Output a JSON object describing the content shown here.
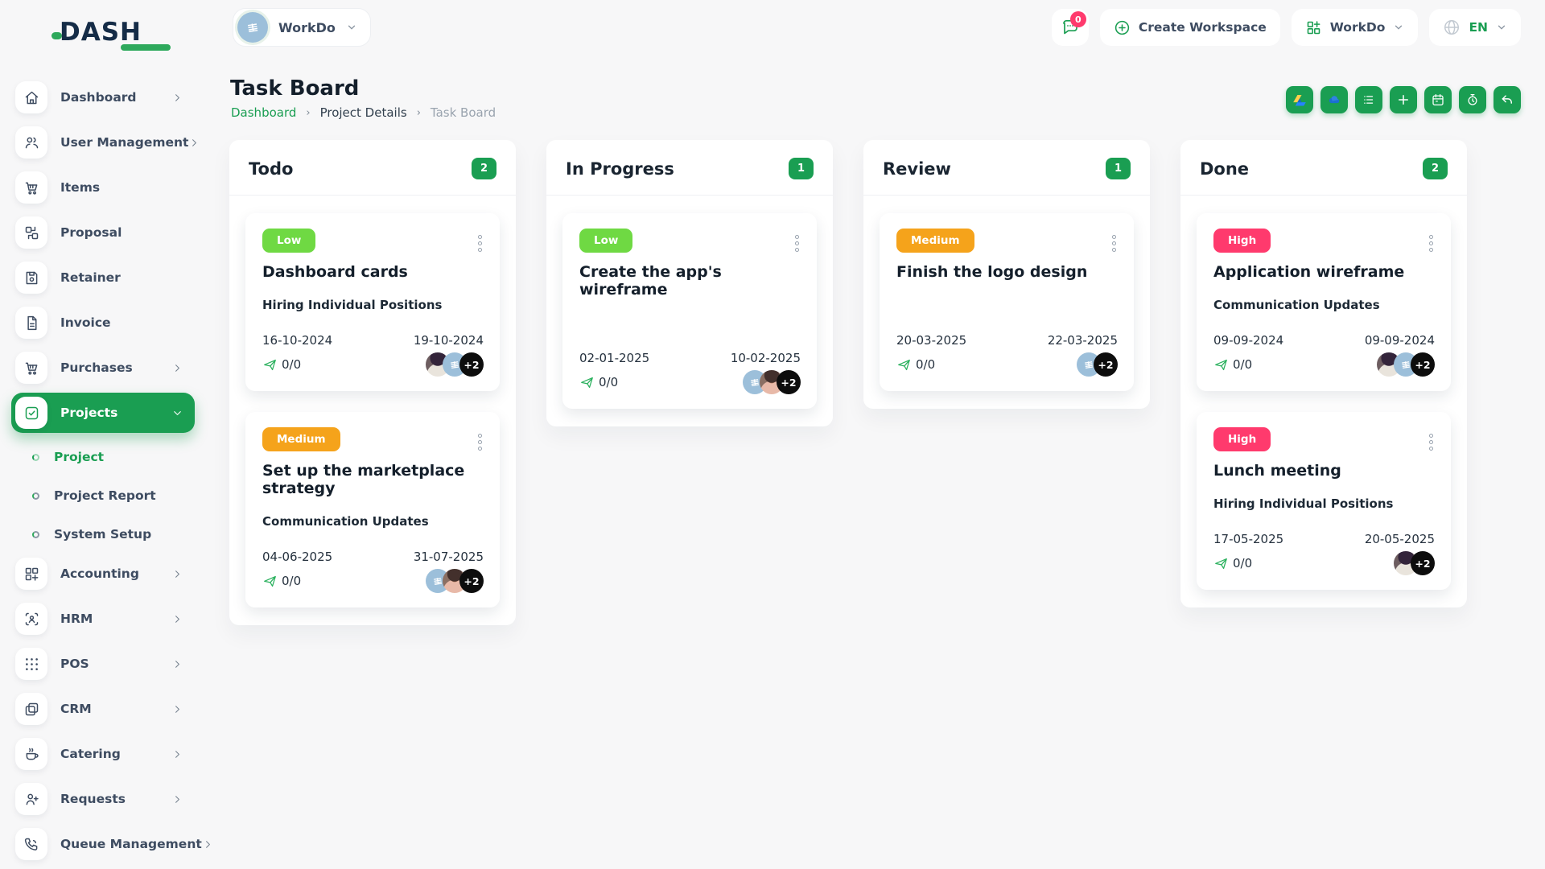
{
  "brand": {
    "logo_text": "DASH"
  },
  "header": {
    "workspace_pill": {
      "label": "WorkDo",
      "avatar_icon": "building-icon"
    },
    "messages": {
      "badge": "0",
      "icon": "chat-icon"
    },
    "create_workspace": {
      "label": "Create Workspace",
      "icon": "circle-plus-icon"
    },
    "app_switcher": {
      "label": "WorkDo",
      "icon": "grid-plus-icon"
    },
    "language": {
      "code": "EN",
      "icon": "globe-icon"
    }
  },
  "page": {
    "title": "Task Board",
    "breadcrumb": {
      "0": "Dashboard",
      "1": "Project Details",
      "2": "Task Board"
    }
  },
  "toolbar": {
    "buttons": [
      {
        "icon": "google-drive-icon",
        "name": "google-drive-button"
      },
      {
        "icon": "onedrive-icon",
        "name": "onedrive-button"
      },
      {
        "icon": "list-icon",
        "name": "list-view-button"
      },
      {
        "icon": "plus-icon",
        "name": "add-task-button"
      },
      {
        "icon": "calendar-icon",
        "name": "calendar-button"
      },
      {
        "icon": "alarm-icon",
        "name": "reminder-button"
      },
      {
        "icon": "undo-icon",
        "name": "back-button"
      }
    ]
  },
  "sidebar": {
    "items": [
      {
        "label": "Dashboard",
        "icon": "home",
        "chevron": "right"
      },
      {
        "label": "User Management",
        "icon": "users",
        "chevron": "right"
      },
      {
        "label": "Items",
        "icon": "cart",
        "chevron": ""
      },
      {
        "label": "Proposal",
        "icon": "swap",
        "chevron": ""
      },
      {
        "label": "Retainer",
        "icon": "save",
        "chevron": ""
      },
      {
        "label": "Invoice",
        "icon": "file",
        "chevron": ""
      },
      {
        "label": "Purchases",
        "icon": "cart",
        "chevron": "right"
      },
      {
        "label": "Projects",
        "icon": "check-square",
        "chevron": "down",
        "active": true,
        "children": [
          {
            "label": "Project",
            "active": true
          },
          {
            "label": "Project Report",
            "active": false
          },
          {
            "label": "System Setup",
            "active": false
          }
        ]
      },
      {
        "label": "Accounting",
        "icon": "grid-plus",
        "chevron": "right"
      },
      {
        "label": "HRM",
        "icon": "scan-user",
        "chevron": "right"
      },
      {
        "label": "POS",
        "icon": "dots-grid",
        "chevron": "right"
      },
      {
        "label": "CRM",
        "icon": "windows",
        "chevron": "right"
      },
      {
        "label": "Catering",
        "icon": "coffee",
        "chevron": "right"
      },
      {
        "label": "Requests",
        "icon": "user-plus",
        "chevron": "right"
      },
      {
        "label": "Queue Management",
        "icon": "phone",
        "chevron": "right"
      }
    ]
  },
  "board": {
    "columns": [
      {
        "title": "Todo",
        "count": "2",
        "cards": [
          {
            "priority": "Low",
            "title": "Dashboard cards",
            "milestone": "Hiring Individual Positions",
            "start_date": "16-10-2024",
            "end_date": "19-10-2024",
            "progress": "0/0",
            "avatars": [
              "photo1",
              "workdo"
            ],
            "overflow": "+2"
          },
          {
            "priority": "Medium",
            "title": "Set up the marketplace strategy",
            "milestone": "Communication Updates",
            "start_date": "04-06-2025",
            "end_date": "31-07-2025",
            "progress": "0/0",
            "avatars": [
              "workdo",
              "photo2"
            ],
            "overflow": "+2"
          }
        ]
      },
      {
        "title": "In Progress",
        "count": "1",
        "cards": [
          {
            "priority": "Low",
            "title": "Create the app's wireframe",
            "milestone": "",
            "start_date": "02-01-2025",
            "end_date": "10-02-2025",
            "progress": "0/0",
            "avatars": [
              "workdo",
              "photo2"
            ],
            "overflow": "+2"
          }
        ]
      },
      {
        "title": "Review",
        "count": "1",
        "cards": [
          {
            "priority": "Medium",
            "title": "Finish the logo design",
            "milestone": "",
            "start_date": "20-03-2025",
            "end_date": "22-03-2025",
            "progress": "0/0",
            "avatars": [
              "workdo"
            ],
            "overflow": "+2"
          }
        ]
      },
      {
        "title": "Done",
        "count": "2",
        "cards": [
          {
            "priority": "High",
            "title": "Application wireframe",
            "milestone": "Communication Updates",
            "start_date": "09-09-2024",
            "end_date": "09-09-2024",
            "progress": "0/0",
            "avatars": [
              "photo1",
              "workdo"
            ],
            "overflow": "+2"
          },
          {
            "priority": "High",
            "title": "Lunch meeting",
            "milestone": "Hiring Individual Positions",
            "start_date": "17-05-2025",
            "end_date": "20-05-2025",
            "progress": "0/0",
            "avatars": [
              "photo1"
            ],
            "overflow": "+2"
          }
        ]
      }
    ]
  },
  "colors": {
    "primary_green": "#1a9e52",
    "badge_low": "#6fd943",
    "badge_medium": "#f5a31b",
    "badge_high": "#ff3a6d",
    "notification_pink": "#ff3a6d",
    "overflow_black": "#0d0d0d",
    "workdo_avatar_blue": "#9cbfda"
  }
}
